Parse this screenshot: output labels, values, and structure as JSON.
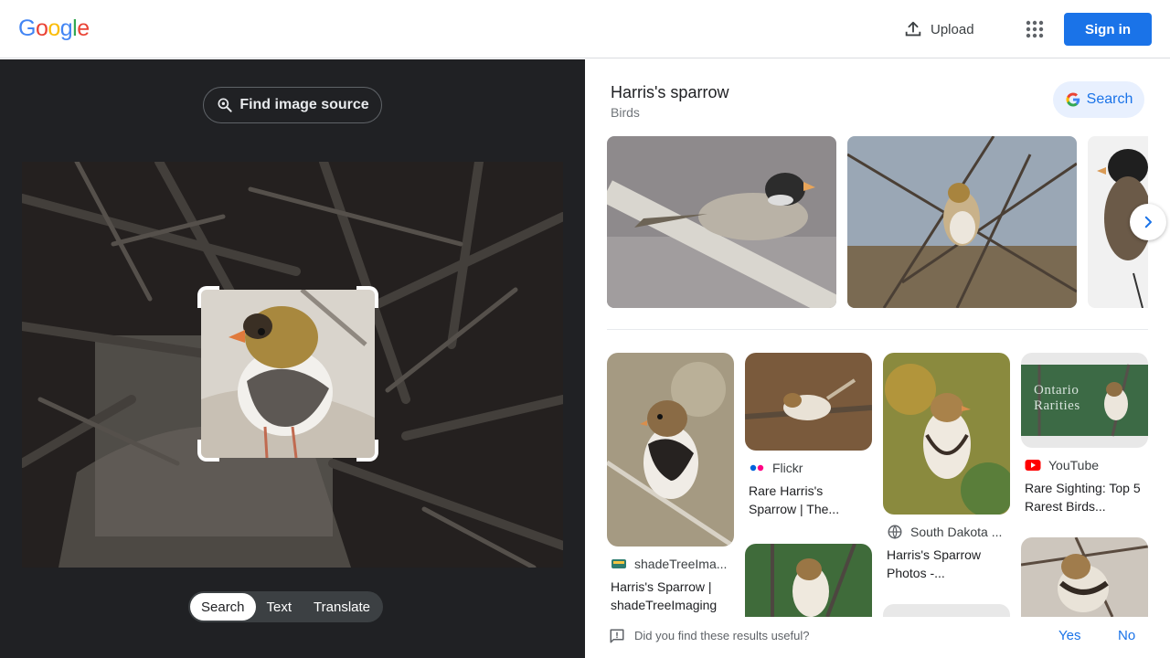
{
  "header": {
    "logo_letters": [
      "G",
      "o",
      "o",
      "g",
      "l",
      "e"
    ],
    "logo_colors": [
      "#4285F4",
      "#EA4335",
      "#FBBC05",
      "#4285F4",
      "#34A853",
      "#EA4335"
    ],
    "upload_label": "Upload",
    "apps_icon": "apps-grid-icon",
    "signin_label": "Sign in"
  },
  "left": {
    "find_source_label": "Find image source",
    "tabs": [
      {
        "label": "Search",
        "active": true
      },
      {
        "label": "Text",
        "active": false
      },
      {
        "label": "Translate",
        "active": false
      }
    ]
  },
  "knowledge": {
    "title": "Harris's sparrow",
    "subtitle": "Birds",
    "search_label": "Search"
  },
  "results": [
    {
      "source": "shadeTreeIma...",
      "title": "Harris's Sparrow | shadeTreeImaging"
    },
    {
      "source": "Flickr",
      "title": "Rare Harris's Sparrow | The..."
    },
    {
      "source": "South Dakota ...",
      "title": "Harris's Sparrow Photos -..."
    },
    {
      "source": "YouTube",
      "title": "Rare Sighting: Top 5 Rarest Birds...",
      "overlay_lines": [
        "Ontario",
        "Rarities"
      ]
    }
  ],
  "feedback": {
    "question": "Did you find these results useful?",
    "yes": "Yes",
    "no": "No"
  },
  "colors": {
    "accent": "#1a73e8",
    "dark_panel": "#202124"
  }
}
